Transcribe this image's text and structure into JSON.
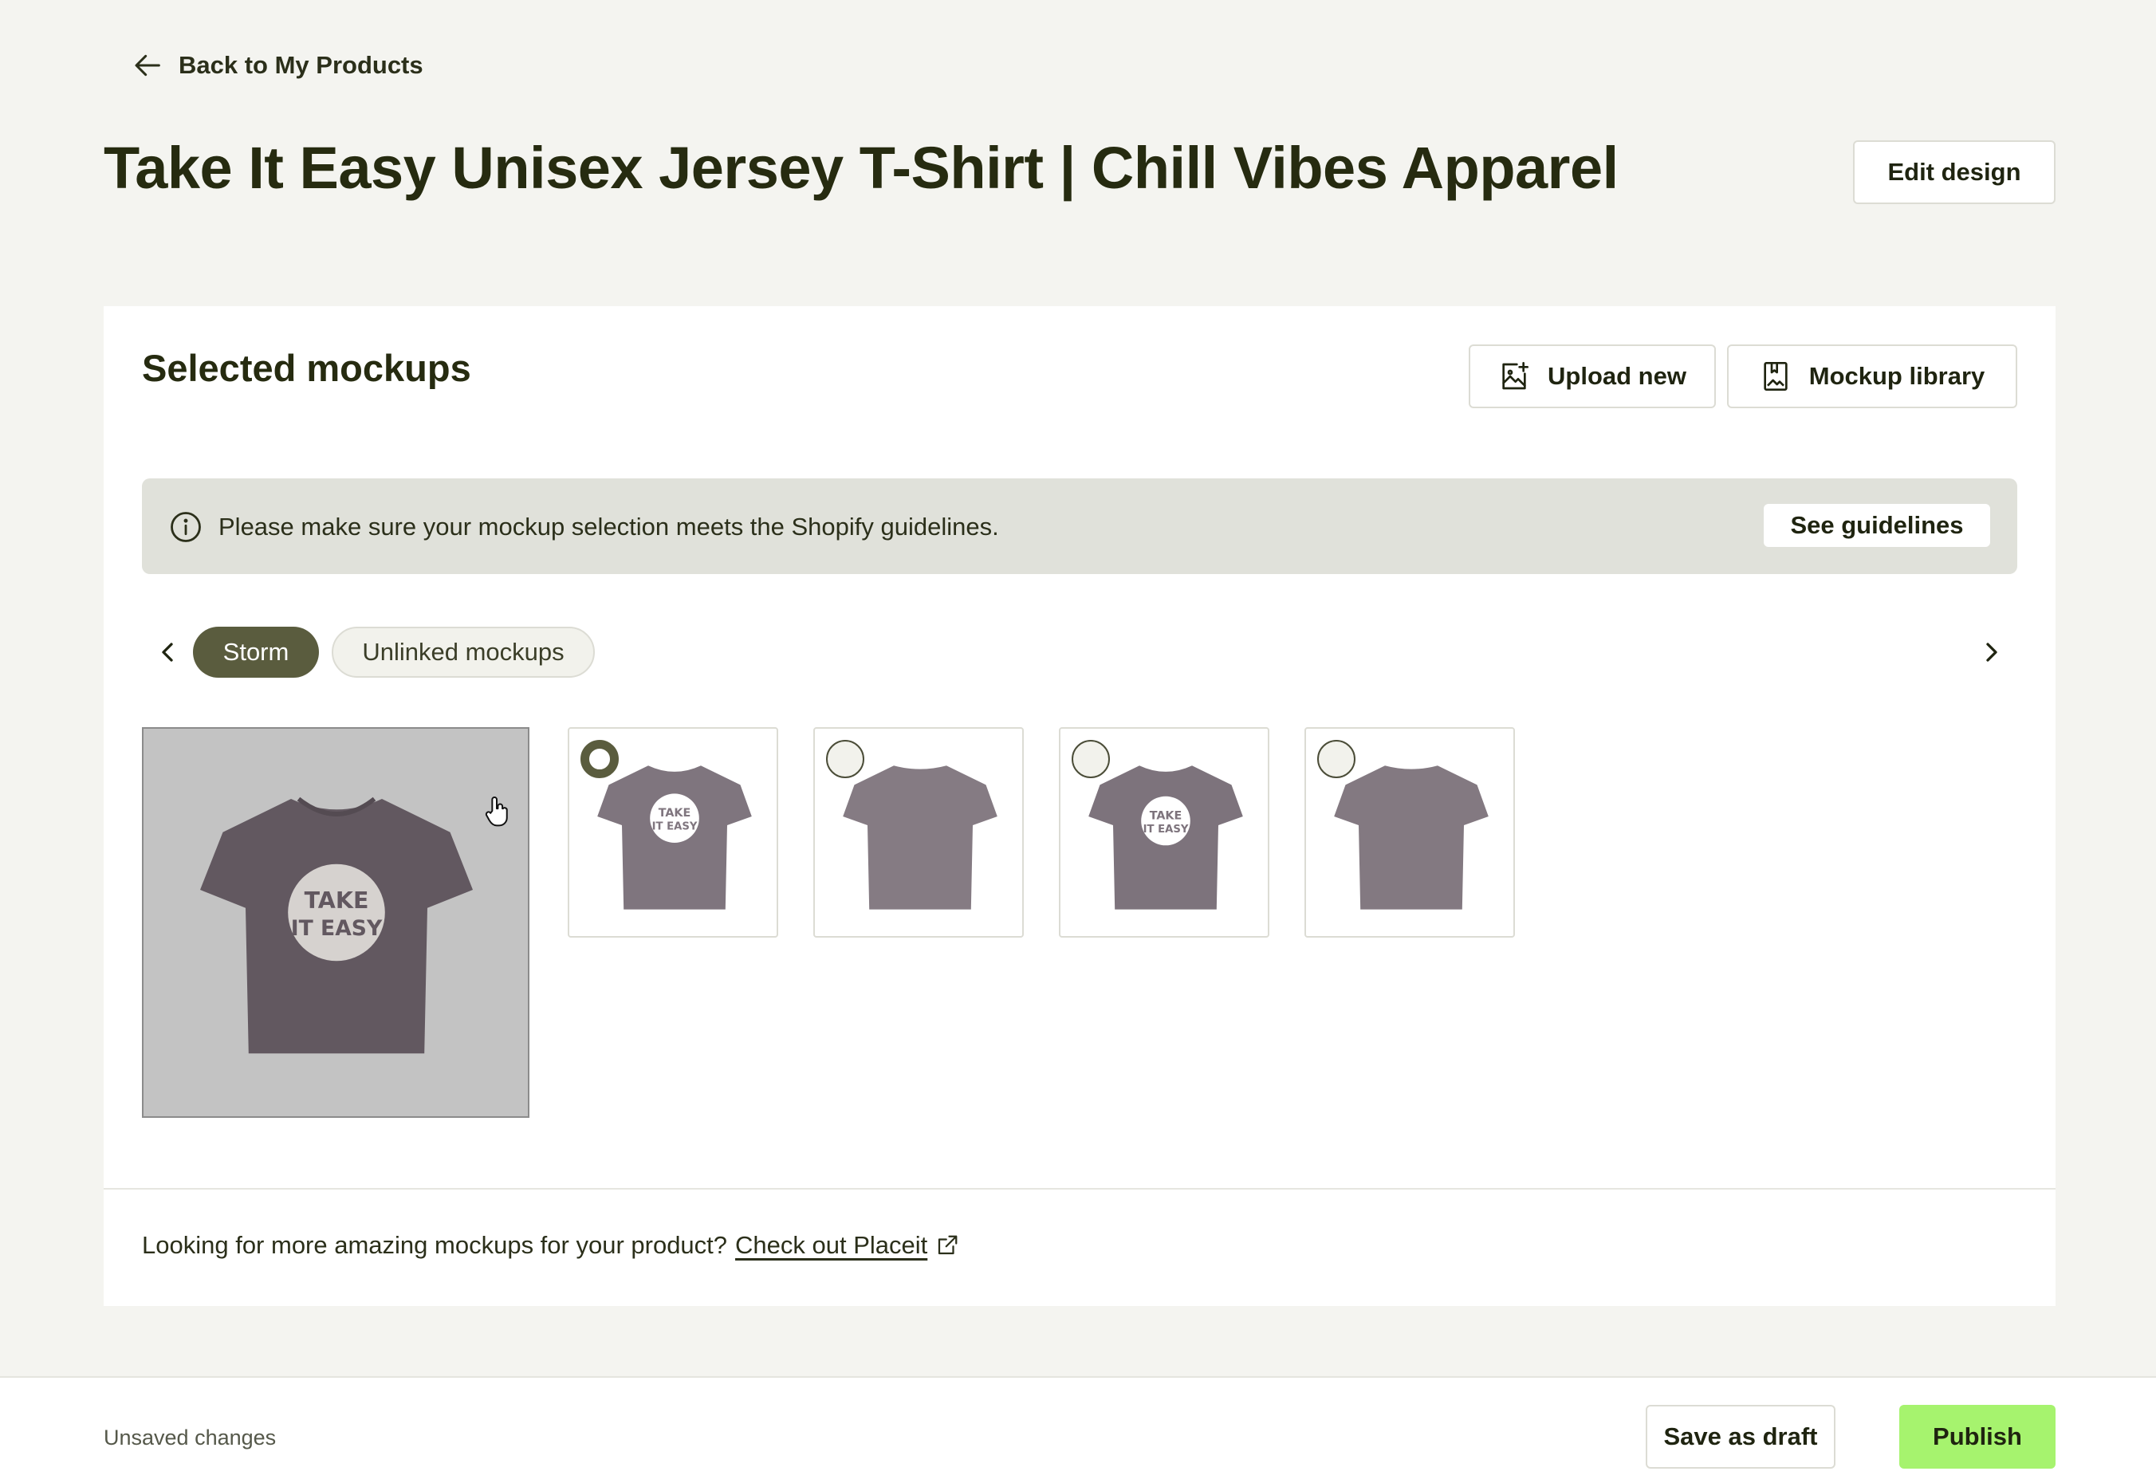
{
  "nav": {
    "back_label": "Back to My Products"
  },
  "header": {
    "title": "Take It Easy Unisex Jersey T-Shirt | Chill Vibes Apparel",
    "edit_design_label": "Edit design"
  },
  "mockups": {
    "title": "Selected mockups",
    "upload_label": "Upload new",
    "library_label": "Mockup library",
    "banner": {
      "text": "Please make sure your mockup selection meets the Shopify guidelines.",
      "button_label": "See guidelines"
    },
    "tabs": [
      {
        "label": "Storm",
        "active": true
      },
      {
        "label": "Unlinked mockups",
        "active": false
      }
    ],
    "main_preview": {
      "design_text": "TAKE IT EASY",
      "shirt_color": "#625860",
      "background": "#c3c3c3"
    },
    "thumbnails": [
      {
        "selected": true,
        "has_design": true
      },
      {
        "selected": false,
        "has_design": false
      },
      {
        "selected": false,
        "has_design": true
      },
      {
        "selected": false,
        "has_design": false
      }
    ],
    "footer": {
      "text": "Looking for more amazing mockups for your product?",
      "link_label": "Check out Placeit"
    }
  },
  "bottom_bar": {
    "status": "Unsaved changes",
    "draft_label": "Save as draft",
    "publish_label": "Publish"
  },
  "colors": {
    "accent_pill": "#5a5c3e",
    "publish": "#a6f36e",
    "shirt": "#7f757e"
  }
}
